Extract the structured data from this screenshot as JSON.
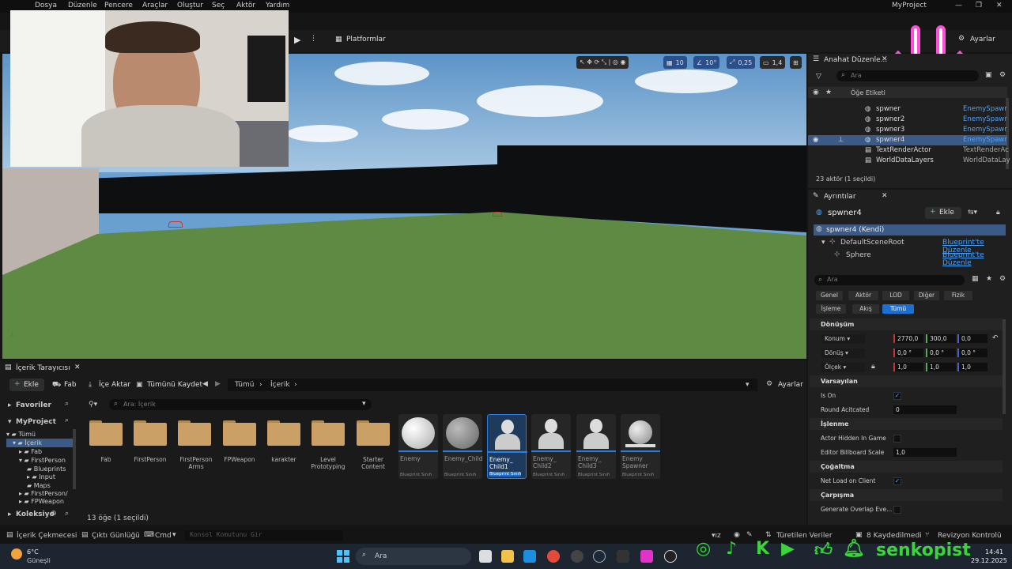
{
  "menu": {
    "items": [
      "Dosya",
      "Düzenle",
      "Pencere",
      "Araçlar",
      "Oluştur",
      "Seç",
      "Aktör",
      "Yardım"
    ],
    "project": "MyProject"
  },
  "toolbar": {
    "platforms": "Platformlar",
    "settings": "Ayarlar"
  },
  "viewport": {
    "grid": "10",
    "angle": "10°",
    "scale": "0,25",
    "camera": "1,4"
  },
  "outliner": {
    "title": "Anahat Düzenle...",
    "search_placeholder": "Ara",
    "header_label": "Öğe Etiketi",
    "rows": [
      {
        "label": "spwner",
        "type": "EnemySpawr"
      },
      {
        "label": "spwner2",
        "type": "EnemySpawr"
      },
      {
        "label": "spwner3",
        "type": "EnemySpawr"
      },
      {
        "label": "spwner4",
        "type": "EnemySpawr"
      },
      {
        "label": "TextRenderActor",
        "type": "TextRenderAc"
      },
      {
        "label": "WorldDataLayers",
        "type": "WorldDataLay"
      }
    ],
    "status": "23 aktör (1 seçildi)"
  },
  "details": {
    "title": "Ayrıntılar",
    "actor_name": "spwner4",
    "add_label": "Ekle",
    "self_label": "spwner4 (Kendi)",
    "components": [
      {
        "name": "DefaultSceneRoot",
        "link": "Blueprint'te Düzenle"
      },
      {
        "name": "Sphere",
        "link": "Blueprint'te Düzenle"
      }
    ],
    "search_placeholder": "Ara",
    "filters_row1": [
      "Genel",
      "Aktör",
      "LOD",
      "Diğer",
      "Fizik"
    ],
    "filters_row2": [
      "İşleme",
      "Akış",
      "Tümü"
    ],
    "transform": {
      "section": "Dönüşüm",
      "location_label": "Konum",
      "location": [
        "2770,0",
        "300,0",
        "0,0"
      ],
      "rotation_label": "Dönüş",
      "rotation": [
        "0,0 °",
        "0,0 °",
        "0,0 °"
      ],
      "scale_label": "Ölçek",
      "scale": [
        "1,0",
        "1,0",
        "1,0"
      ]
    },
    "defaults": {
      "section": "Varsayılan",
      "is_on": "Is On",
      "round_label": "Round Acitcated",
      "round_value": "0"
    },
    "rendering": {
      "section": "İşlenme",
      "hidden": "Actor Hidden In Game",
      "billboard": "Editor Billboard Scale",
      "billboard_value": "1,0"
    },
    "replication": {
      "section": "Çoğaltma",
      "net_load": "Net Load on Client"
    },
    "collision": {
      "section": "Çarpışma",
      "overlap": "Generate Overlap Eve..."
    }
  },
  "content_browser": {
    "tab": "İçerik Tarayıcısı",
    "add": "Ekle",
    "fab": "Fab",
    "import": "İçe Aktar",
    "save_all": "Tümünü Kaydet",
    "path": [
      "Tümü",
      "İçerik"
    ],
    "settings": "Ayarlar",
    "search_placeholder": "Ara: İçerik",
    "favorites": "Favoriler",
    "project": "MyProject",
    "tree": [
      "Tümü",
      "İçerik",
      "Fab",
      "FirstPerson",
      "Blueprints",
      "Input",
      "Maps",
      "FirstPerson/",
      "FPWeapon"
    ],
    "collections": "Koleksiyo",
    "folders": [
      "Fab",
      "FirstPerson",
      "FirstPerson Arms",
      "FPWeapon",
      "karakter",
      "Level Prototyping",
      "Starter Content"
    ],
    "assets": [
      {
        "name": "Enemy",
        "sub": "Blueprint Sınıfı"
      },
      {
        "name": "Enemy_Child",
        "sub": "Blueprint Sınıfı"
      },
      {
        "name": "Enemy_ Child1",
        "sub": "Blueprint Sınıfı"
      },
      {
        "name": "Enemy_ Child2",
        "sub": "Blueprint Sınıfı"
      },
      {
        "name": "Enemy_ Child3",
        "sub": "Blueprint Sınıfı"
      },
      {
        "name": "Enemy Spawner",
        "sub": "Blueprint Sınıfı"
      }
    ],
    "count": "13 öğe (1 seçildi)"
  },
  "statusbar": {
    "drawer": "İçerik Çekmecesi",
    "output": "Çıktı Günlüğü",
    "cmd": "Cmd",
    "console_placeholder": "Konsol Komutunu Gir",
    "derived": "Türetilen Veriler",
    "unsaved": "8 Kaydedilmedi",
    "revision": "Revizyon Kontrolü"
  },
  "taskbar": {
    "temp": "6°C",
    "weather": "Güneşli",
    "search": "Ara",
    "time": "14:41",
    "date": "29.12.2025"
  },
  "overlay": {
    "channel": "senkopist"
  }
}
